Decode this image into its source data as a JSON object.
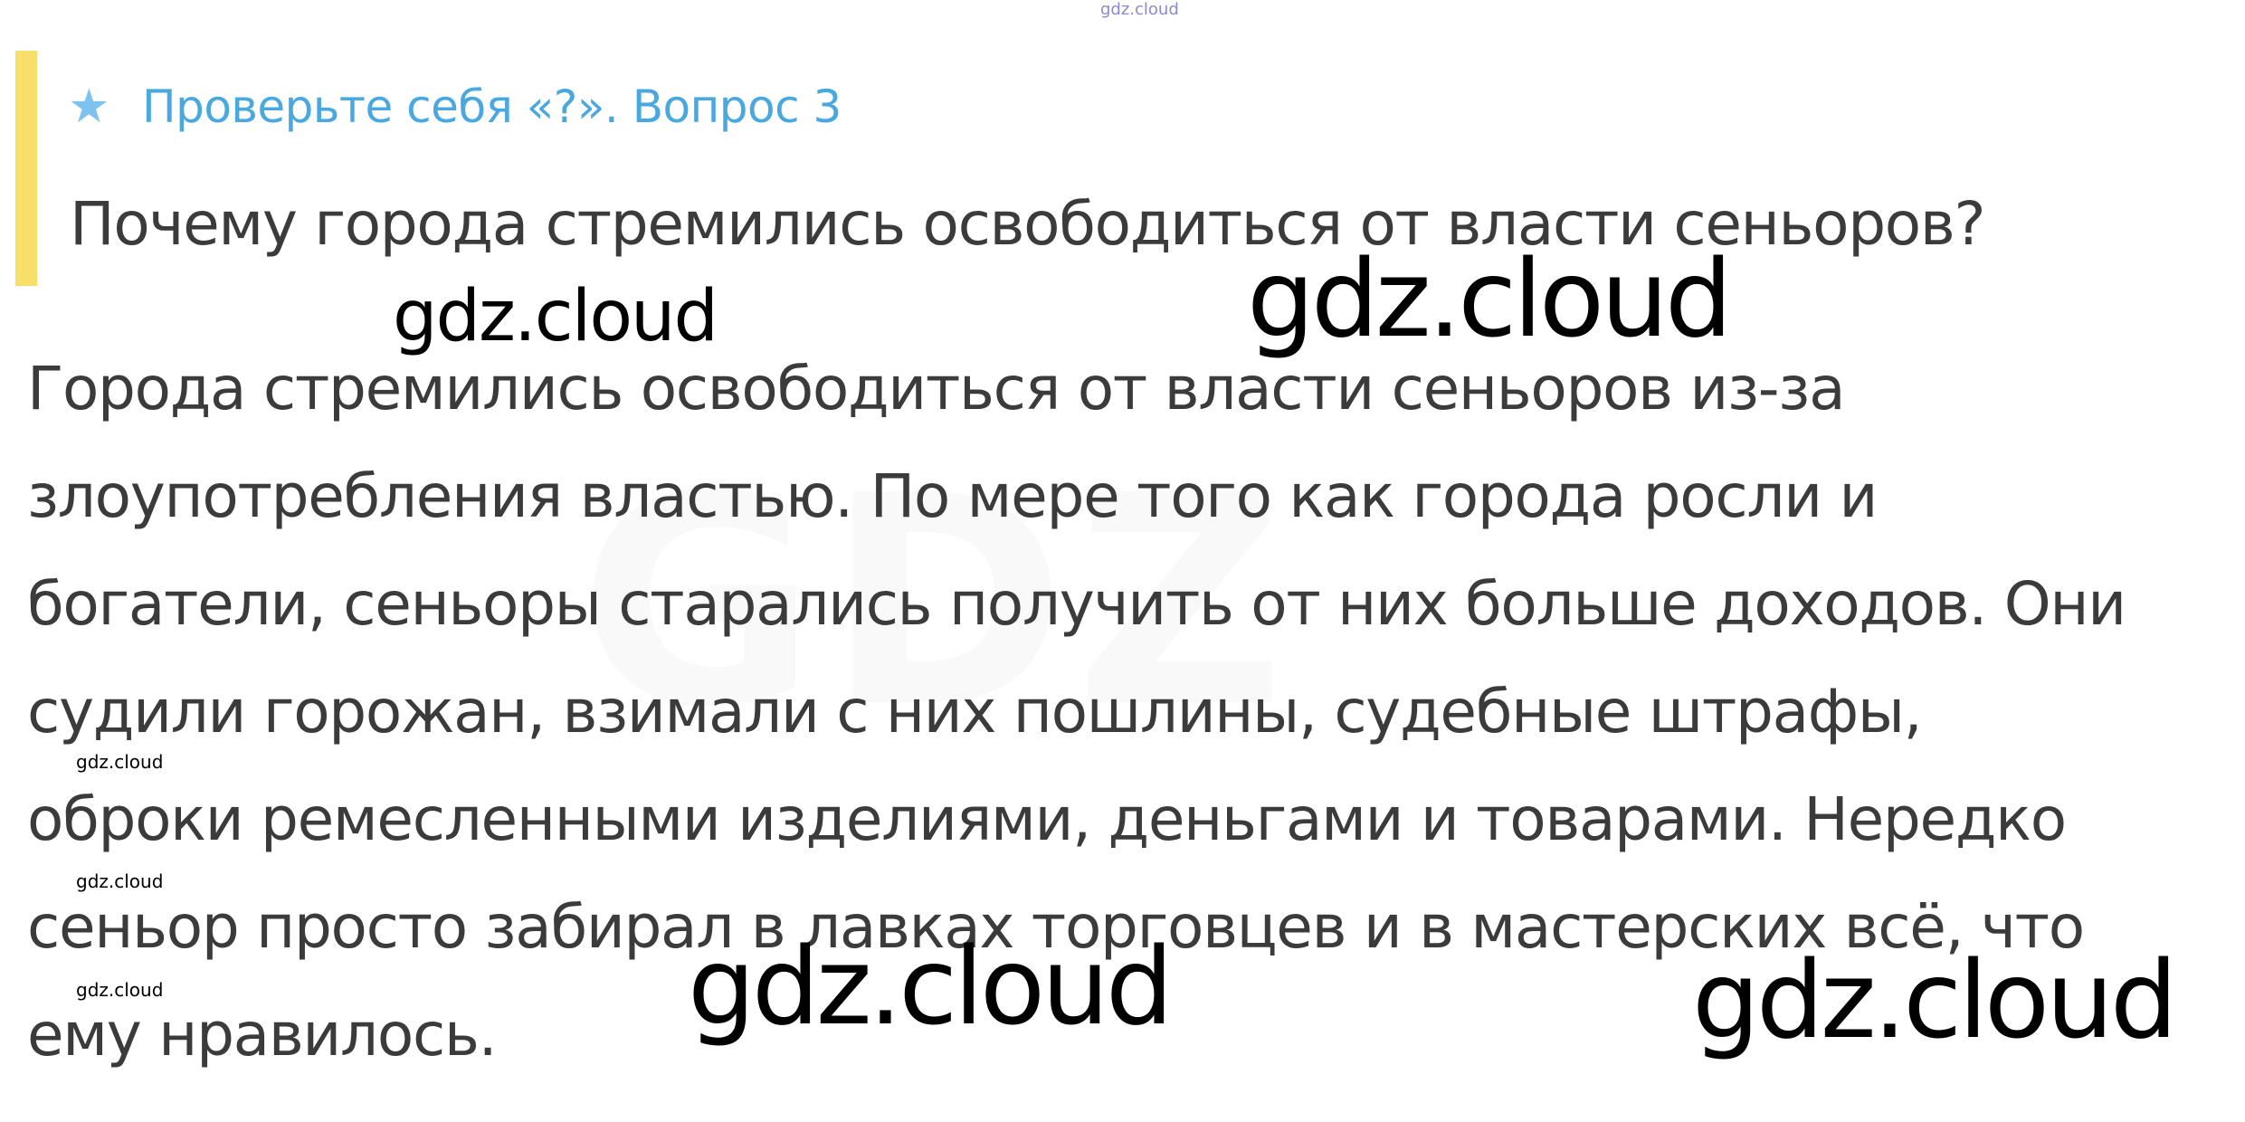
{
  "top_mark": "gdz.cloud",
  "question": {
    "star_icon": "★",
    "title": "Проверьте себя «?». Вопрос 3",
    "text": "Почему города стремились освободиться от власти сеньоров?"
  },
  "answer_lines": [
    "Города стремились освободиться от власти сеньоров из-за",
    "злоупотребления властью. По мере того как города росли и",
    "богатели, сеньоры старались получить от них больше доходов. Они",
    "судили горожан, взимали с них пошлины, судебные штрафы,",
    "оброки ремесленными изделиями, деньгами и товарами. Нередко",
    "сеньор просто забирал в лавках торговцев и в мастерских всё, что",
    "ему нравилось."
  ],
  "watermarks": {
    "upper_left": "gdz.cloud",
    "upper_center": "gdz.cloud",
    "lower_center": "gdz.cloud",
    "lower_right": "gdz.cloud",
    "small_1": "gdz.cloud",
    "small_2": "gdz.cloud",
    "small_3": "gdz.cloud",
    "background_logo": "GDZ"
  },
  "colors": {
    "accent_bar": "#f7df6a",
    "title": "#4aa8e0",
    "star": "#7ec3ef",
    "text": "#3b3b3b"
  }
}
